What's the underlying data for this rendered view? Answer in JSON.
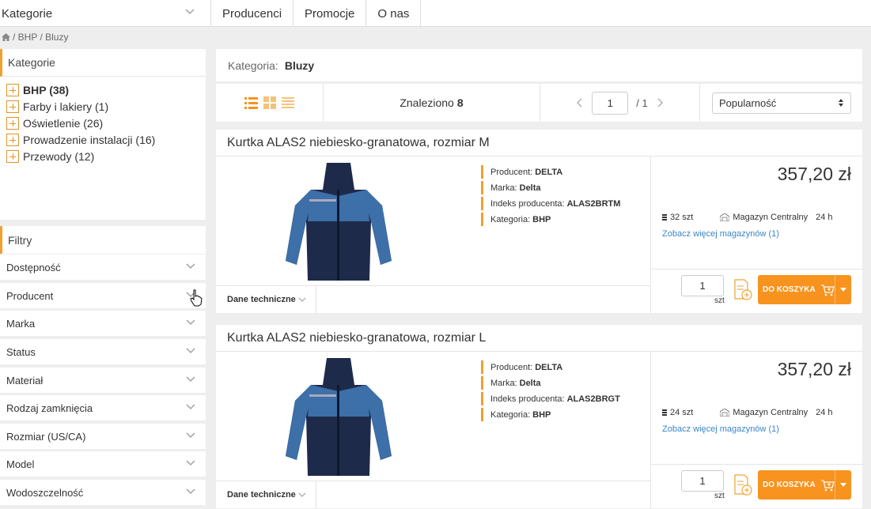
{
  "nav": {
    "categories_label": "Kategorie",
    "links": [
      "Producenci",
      "Promocje",
      "O nas"
    ]
  },
  "breadcrumb": {
    "icon": "home-icon",
    "text": "/ BHP / Bluzy"
  },
  "sidebar": {
    "categories_title": "Kategorie",
    "categories": [
      {
        "label": "BHP (38)",
        "active": true
      },
      {
        "label": "Farby i lakiery (1)",
        "active": false
      },
      {
        "label": "Oświetlenie (26)",
        "active": false
      },
      {
        "label": "Prowadzenie instalacji (16)",
        "active": false
      },
      {
        "label": "Przewody (12)",
        "active": false
      }
    ],
    "filters_title": "Filtry",
    "filters": [
      "Dostępność",
      "Producent",
      "Marka",
      "Status",
      "Materiał",
      "Rodzaj zamknięcia",
      "Rozmiar (US/CA)",
      "Model",
      "Wodoszczelność"
    ]
  },
  "category_bar": {
    "label": "Kategoria:",
    "value": "Bluzy"
  },
  "toolbar": {
    "found_label": "Znaleziono",
    "found_count": "8",
    "page_value": "1",
    "page_total": "/ 1",
    "sort_value": "Popularność"
  },
  "products": [
    {
      "title": "Kurtka ALAS2 niebiesko-granatowa, rozmiar M",
      "attrs": [
        {
          "label": "Producent:",
          "value": "DELTA"
        },
        {
          "label": "Marka:",
          "value": "Delta"
        },
        {
          "label": "Indeks producenta:",
          "value": "ALAS2BRTM"
        },
        {
          "label": "Kategoria:",
          "value": "BHP"
        }
      ],
      "tech_label": "Dane techniczne",
      "price": "357,20 zł",
      "stock_qty": "32 szt",
      "warehouse": "Magazyn Centralny",
      "delivery": "24 h",
      "more_link": "Zobacz więcej magazynów (1)",
      "qty": "1",
      "unit": "szt",
      "cart_label": "DO KOSZYKA"
    },
    {
      "title": "Kurtka ALAS2 niebiesko-granatowa, rozmiar L",
      "attrs": [
        {
          "label": "Producent:",
          "value": "DELTA"
        },
        {
          "label": "Marka:",
          "value": "Delta"
        },
        {
          "label": "Indeks producenta:",
          "value": "ALAS2BRGT"
        },
        {
          "label": "Kategoria:",
          "value": "BHP"
        }
      ],
      "tech_label": "Dane techniczne",
      "price": "357,20 zł",
      "stock_qty": "24 szt",
      "warehouse": "Magazyn Centralny",
      "delivery": "24 h",
      "more_link": "Zobacz więcej magazynów (1)",
      "qty": "1",
      "unit": "szt",
      "cart_label": "DO KOSZYKA"
    }
  ],
  "colors": {
    "accent": "#f7931e",
    "link": "#3a86c8",
    "jacket_navy": "#1e2a4a",
    "jacket_blue": "#3d6fa8"
  }
}
